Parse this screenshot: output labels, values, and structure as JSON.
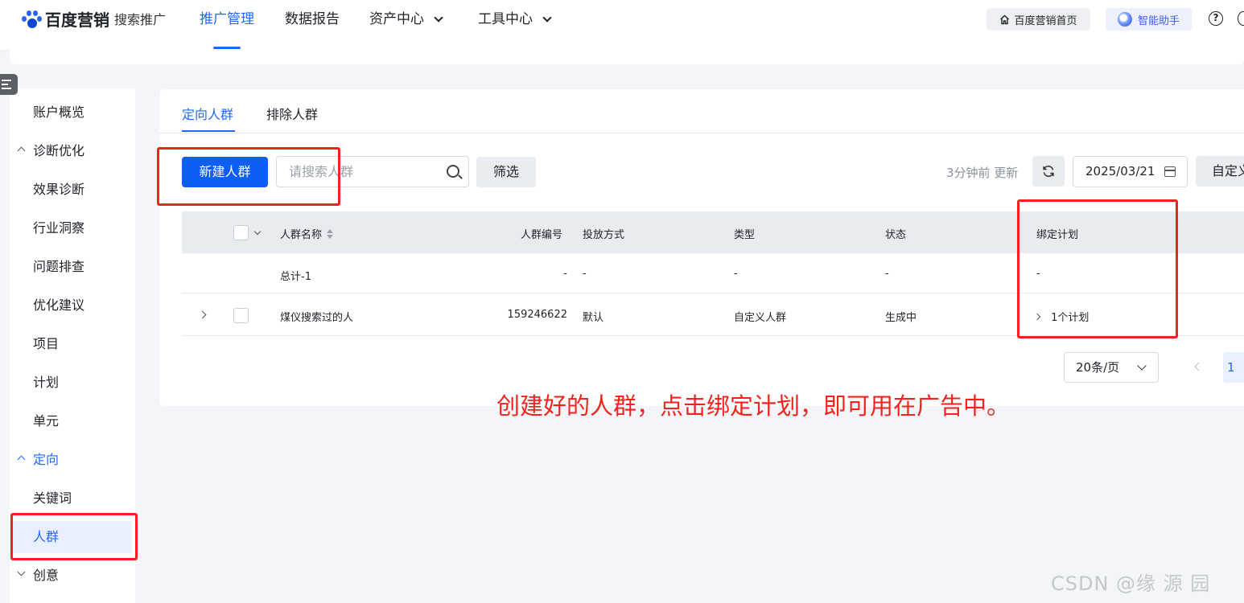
{
  "header": {
    "logo_brand": "百度营销",
    "logo_sub": "搜索推广",
    "nav": [
      {
        "label": "推广管理",
        "active": true
      },
      {
        "label": "数据报告"
      },
      {
        "label": "资产中心"
      },
      {
        "label": "工具中心"
      }
    ],
    "home_label": "百度营销首页",
    "ai_label": "智能助手",
    "help_glyph": "?"
  },
  "sidebar": {
    "items": [
      {
        "label": "账户概览"
      },
      {
        "label": "诊断优化"
      },
      {
        "label": "效果诊断"
      },
      {
        "label": "行业洞察"
      },
      {
        "label": "问题排查"
      },
      {
        "label": "优化建议"
      },
      {
        "label": "项目"
      },
      {
        "label": "计划"
      },
      {
        "label": "单元"
      },
      {
        "label": "定向"
      },
      {
        "label": "关键词"
      },
      {
        "label": "人群"
      },
      {
        "label": "创意"
      }
    ]
  },
  "tabs": [
    {
      "label": "定向人群",
      "active": true
    },
    {
      "label": "排除人群"
    }
  ],
  "toolbar": {
    "new_label": "新建人群",
    "search_placeholder": "请搜索人群",
    "filter_label": "筛选",
    "update_text": "3分钟前 更新",
    "date": "2025/03/21",
    "custom_label": "自定义"
  },
  "table": {
    "headers": {
      "name": "人群名称",
      "id": "人群编号",
      "delivery": "投放方式",
      "type": "类型",
      "status": "状态",
      "plans": "绑定计划"
    },
    "total_row": {
      "name": "总计-1",
      "id": "-",
      "delivery": "-",
      "type": "-",
      "status": "-",
      "plans": "-"
    },
    "rows": [
      {
        "name": "煤仪搜索过的人",
        "id": "159246622",
        "delivery": "默认",
        "type": "自定义人群",
        "status": "生成中",
        "plans": "1个计划"
      }
    ]
  },
  "pagination": {
    "page_size": "20条/页",
    "current_page": "1"
  },
  "annotation": {
    "text": "创建好的人群，点击绑定计划，即可用在广告中。",
    "color": "#f2231d"
  },
  "watermark": "CSDN @缘 源 园",
  "colors": {
    "primary": "#2468f2",
    "button": "#0c5ef5",
    "annotation": "#f2231d"
  }
}
